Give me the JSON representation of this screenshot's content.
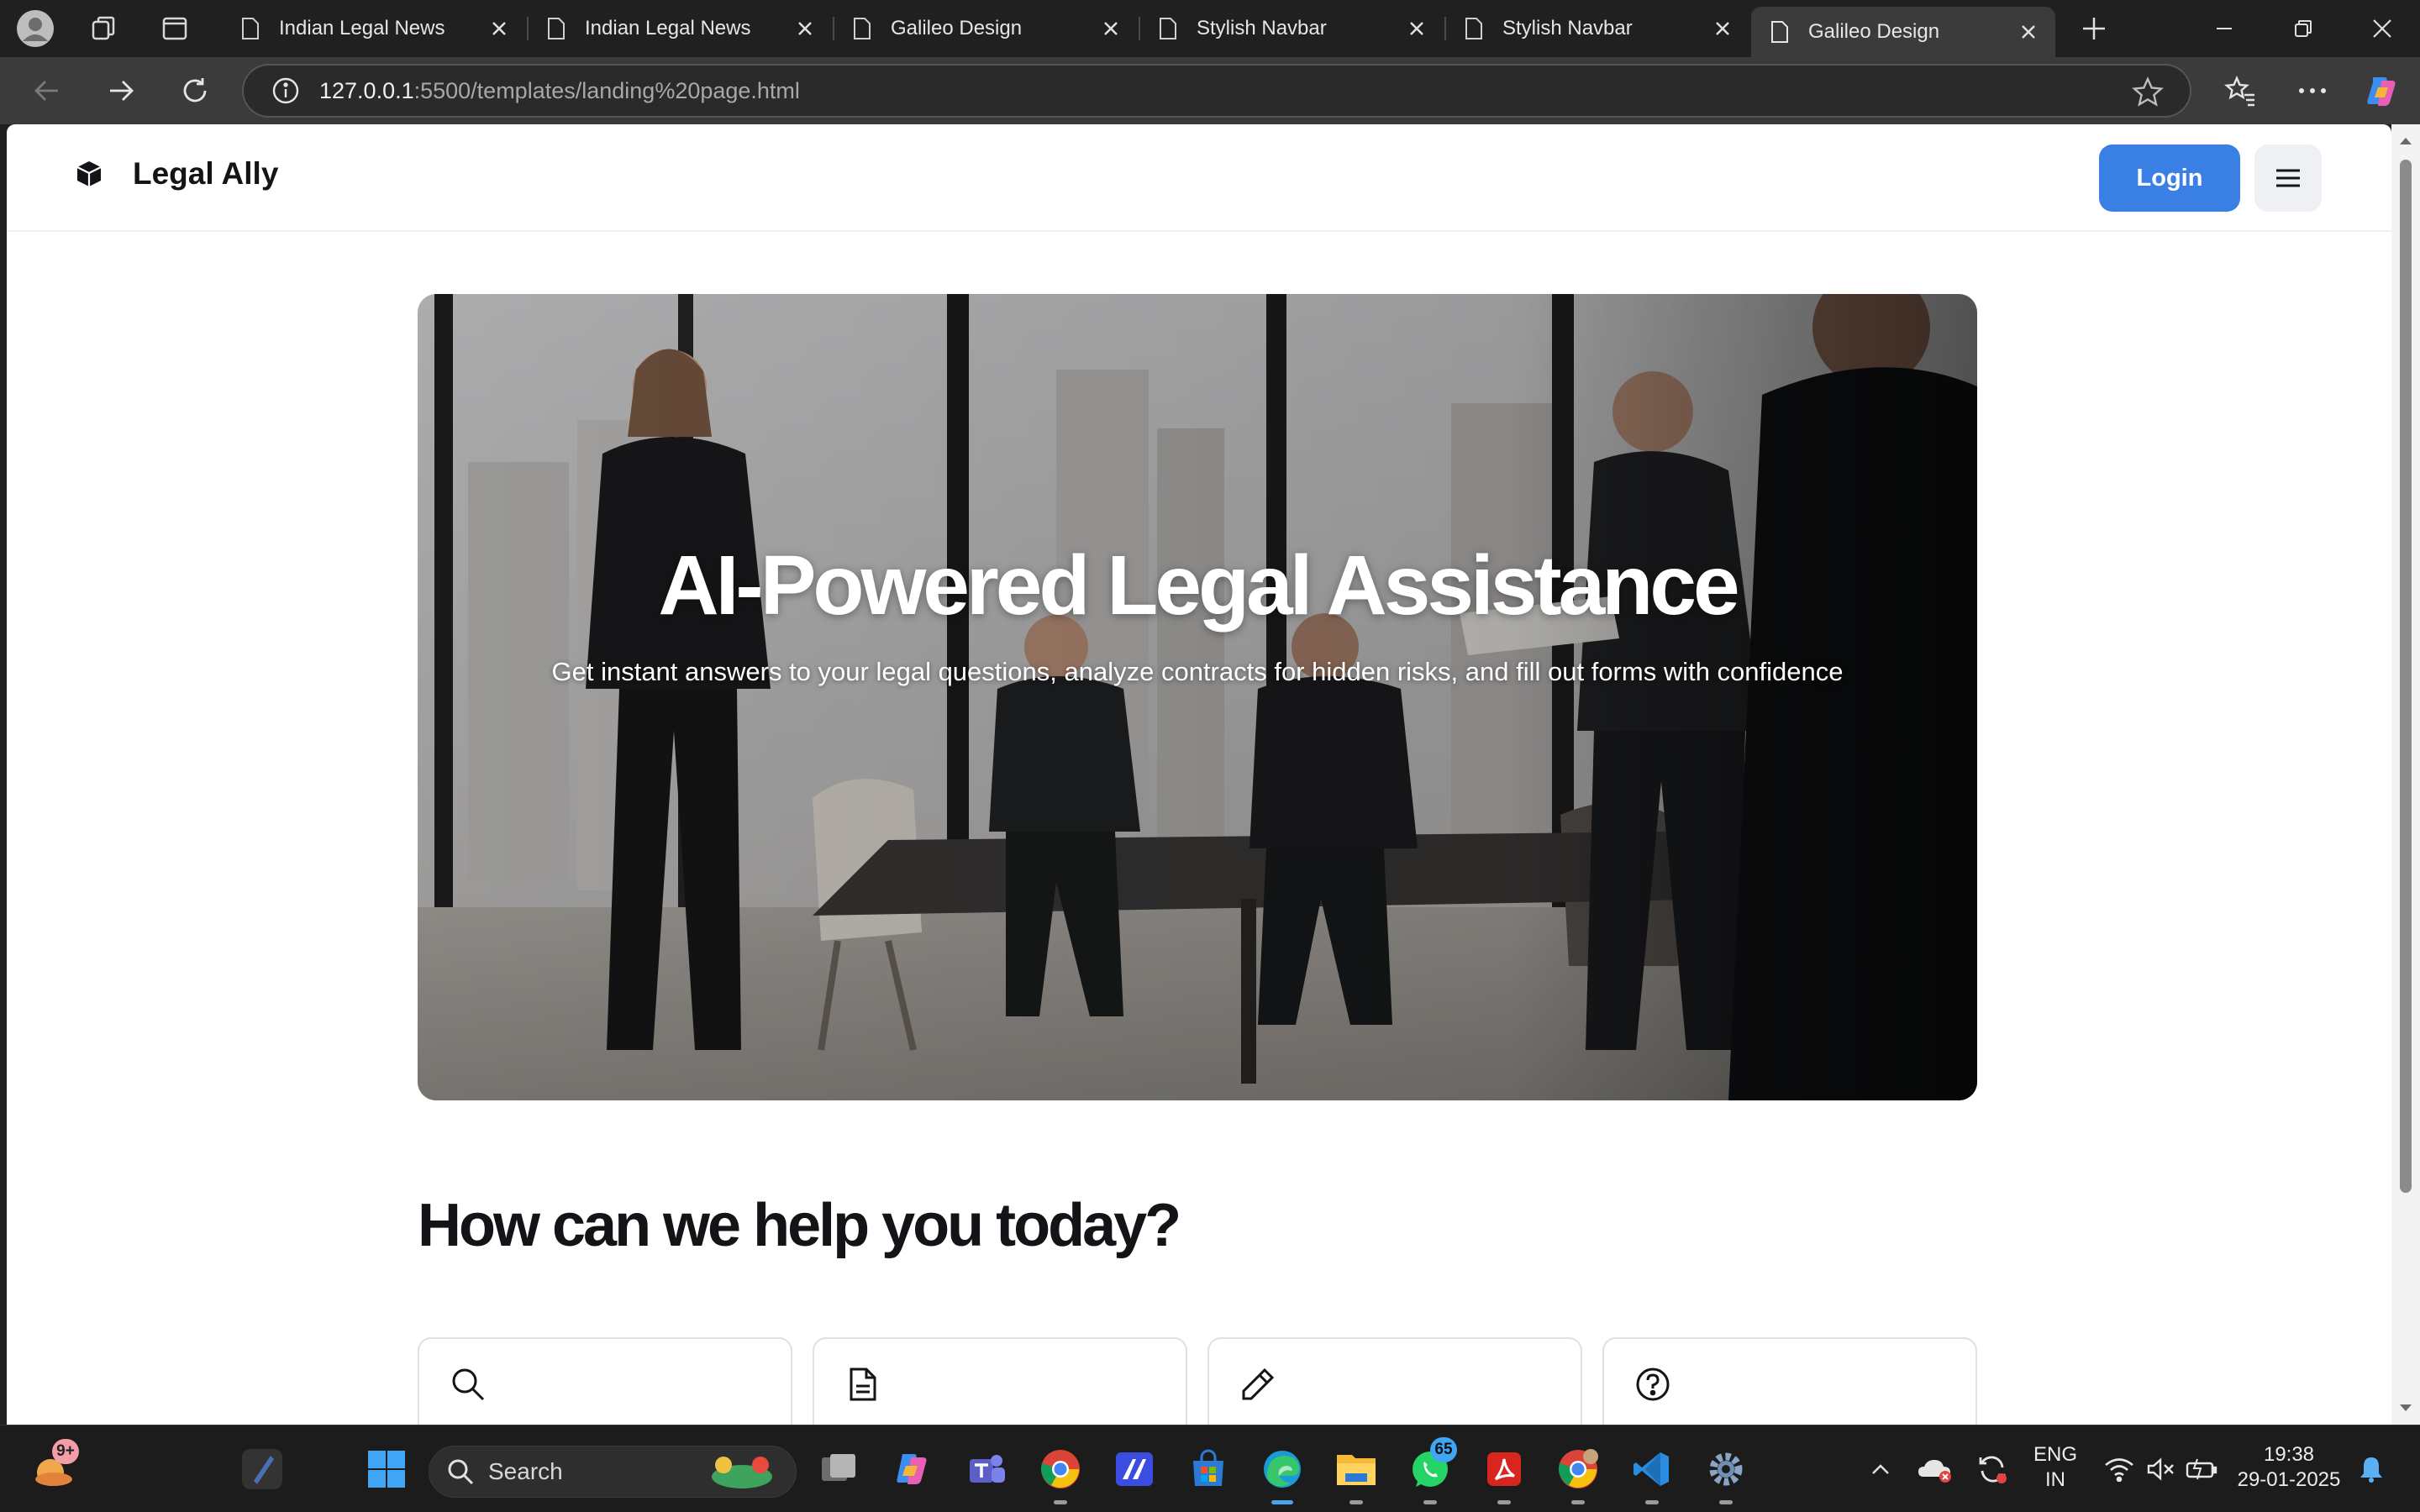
{
  "browser": {
    "tabs": [
      {
        "title": "Indian Legal News",
        "active": false
      },
      {
        "title": "Indian Legal News",
        "active": false
      },
      {
        "title": "Galileo Design",
        "active": false
      },
      {
        "title": "Stylish Navbar",
        "active": false
      },
      {
        "title": "Stylish Navbar",
        "active": false
      },
      {
        "title": "Galileo Design",
        "active": true
      }
    ],
    "address": {
      "host": "127.0.0.1",
      "path": ":5500/templates/landing%20page.html"
    }
  },
  "site": {
    "brand": "Legal Ally",
    "login_label": "Login",
    "hero": {
      "title": "AI-Powered Legal Assistance",
      "subtitle": "Get instant answers to your legal questions, analyze contracts for hidden risks, and fill out forms with confidence"
    },
    "help_heading": "How can we help you today?",
    "cards": [
      {
        "icon": "search-icon"
      },
      {
        "icon": "document-icon"
      },
      {
        "icon": "pencil-icon"
      },
      {
        "icon": "question-icon"
      }
    ]
  },
  "taskbar": {
    "search_label": "Search",
    "weather_badge": "9+",
    "whatsapp_badge": "65",
    "language_line1": "ENG",
    "language_line2": "IN",
    "time": "19:38",
    "date": "29-01-2025"
  },
  "colors": {
    "accent": "#3a7fe4",
    "page_bg": "#ffffff",
    "browser_chrome": "#202020",
    "toolbar": "#3b3b3b"
  }
}
